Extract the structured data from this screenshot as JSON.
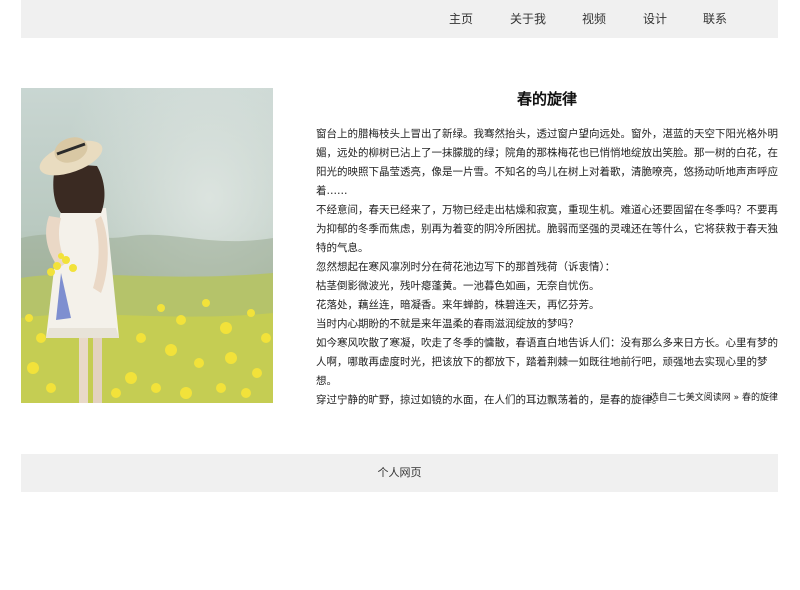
{
  "nav": {
    "items": [
      {
        "label": "主页"
      },
      {
        "label": "关于我"
      },
      {
        "label": "视频"
      },
      {
        "label": "设计"
      },
      {
        "label": "联系"
      }
    ]
  },
  "article": {
    "title": "春的旋律",
    "paragraphs": [
      "窗台上的腊梅枝头上冒出了新绿。我骞然抬头，透过窗户望向远处。窗外，湛蓝的天空下阳光格外明媚，远处的柳树已沾上了一抹朦胧的绿；院角的那株梅花也已悄悄地绽放出笑脸。那一树的白花，在阳光的映照下晶莹透亮，像是一片雪。不知名的鸟儿在树上对着歌，清脆嘹亮，悠扬动听地声声呼应着……",
      "不经意间，春天已经来了，万物已经走出枯燥和寂寞，重现生机。难道心还要固留在冬季吗？不要再为抑郁的冬季而焦虑，别再为着变的阴冷所困扰。脆弱而坚强的灵魂还在等什么，它将获救于春天独特的气息。",
      "忽然想起在寒风凛冽时分在荷花池边写下的那首残荷（诉衷情）：",
      "枯茎倒影微波光，残叶瘪蓬黄。一池暮色如画，无奈自忧伤。",
      "花落处，藕丝连，暗凝香。来年蝉韵，株碧连天，再忆芬芳。",
      "当时内心期盼的不就是来年温柔的春雨滋润绽放的梦吗？",
      "如今寒风吹散了寒凝，吹走了冬季的慵散，春语直白地告诉人们：没有那么多来日方长。心里有梦的人啊，哪敢再虚度时光，把该放下的都放下，踏着荆棘一如既往地前行吧，顽强地去实现心里的梦想。",
      "穿过宁静的旷野，掠过如镜的水面，在人们的耳边飘荡着的，是春的旋律。"
    ],
    "source": "选自二七美文阅读网 » 春的旋律"
  },
  "footer": {
    "text": "个人网页"
  },
  "photo": {
    "icon": "girl-in-flower-field-photo"
  }
}
